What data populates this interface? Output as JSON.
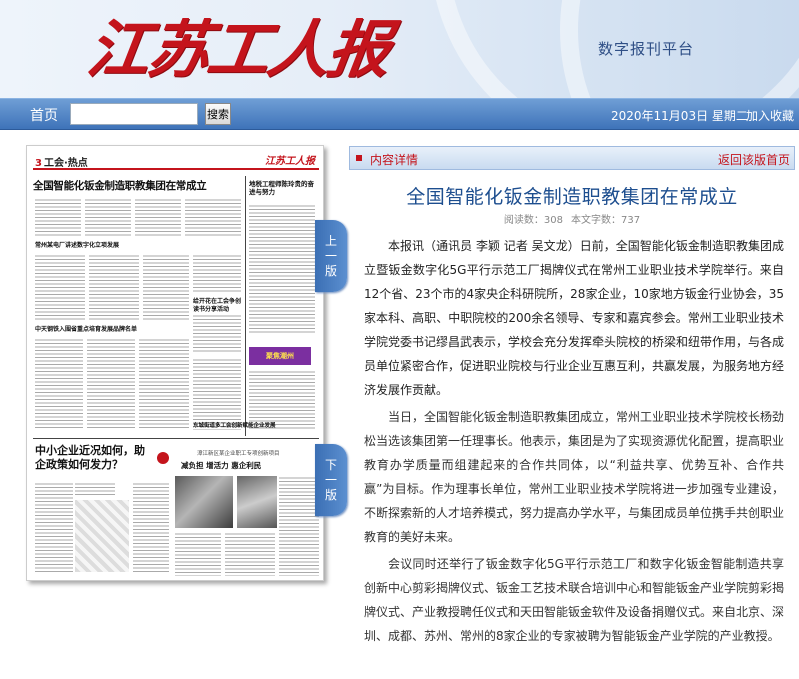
{
  "header": {
    "logo_text": "江苏工人报",
    "platform_label": "数字报刊平台"
  },
  "nav": {
    "home": "首页",
    "search_value": "",
    "search_button": "搜索",
    "date": "2020年11月03日 星期二",
    "favorite": "加入收藏"
  },
  "paper_page": {
    "edition": "工会·热点",
    "edition_no": "3",
    "masthead": "江苏工人报",
    "headline": "全国智能化钣金制造职教集团在常成立",
    "right_story_title": "地税工程师陈玲贵的奋进与努力",
    "sub1": "常州某电厂讲述数字化立项发展",
    "sub2": "中天钢铁入围省重点培育发展品牌名单",
    "sub3": "给开花在工会争创读书分享活动",
    "sub4": "东城街道多工会创新赋能企业发展",
    "ad_text": "聚焦潮州",
    "big_title": "中小企业近况如何，助企政策如何发力？",
    "right_kicker": "漳江新区某企业职工专项创新项目",
    "right_big": "减负担  增活力  惠企利民",
    "prev_tab": [
      "上",
      "一",
      "版"
    ],
    "next_tab": [
      "下",
      "一",
      "版"
    ]
  },
  "article": {
    "bar_label": "内容详情",
    "back_link": "返回该版首页",
    "title": "全国智能化钣金制造职教集团在常成立",
    "read_count": "阅读数：308",
    "word_count": "本文字数：737",
    "paragraphs": [
      "本报讯（通讯员 李颖   记者 吴文龙）日前，全国智能化钣金制造职教集团成立暨钣金数字化5G平行示范工厂揭牌仪式在常州工业职业技术学院举行。来自12个省、23个市的4家央企科研院所，28家企业，10家地方钣金行业协会，35家本科、高职、中职院校的200余名领导、专家和嘉宾参会。常州工业职业技术学院党委书记缪昌武表示，学校会充分发挥牵头院校的桥梁和纽带作用，与各成员单位紧密合作，促进职业院校与行业企业互惠互利，共赢发展，为服务地方经济发展作贡献。",
      "当日，全国智能化钣金制造职教集团成立，常州工业职业技术学院校长杨劲松当选该集团第一任理事长。他表示，集团是为了实现资源优化配置，提高职业教育办学质量而组建起来的合作共同体，以“利益共享、优势互补、合作共赢”为目标。作为理事长单位，常州工业职业技术学院将进一步加强专业建设，不断探索新的人才培养模式，努力提高办学水平，与集团成员单位携手共创职业教育的美好未来。",
      "会议同时还举行了钣金数字化5G平行示范工厂和数字化钣金智能制造共享创新中心剪彩揭牌仪式、钣金工艺技术联合培训中心和智能钣金产业学院剪彩揭牌仪式、产业教授聘任仪式和天田智能钣金软件及设备捐赠仪式。来自北京、深圳、成都、苏州、常州的8家企业的专家被聘为智能钣金产业学院的产业教授。"
    ]
  },
  "colors": {
    "brand_red": "#c4141c",
    "nav_blue": "#3e73b9",
    "title_blue": "#1d4e8f"
  }
}
